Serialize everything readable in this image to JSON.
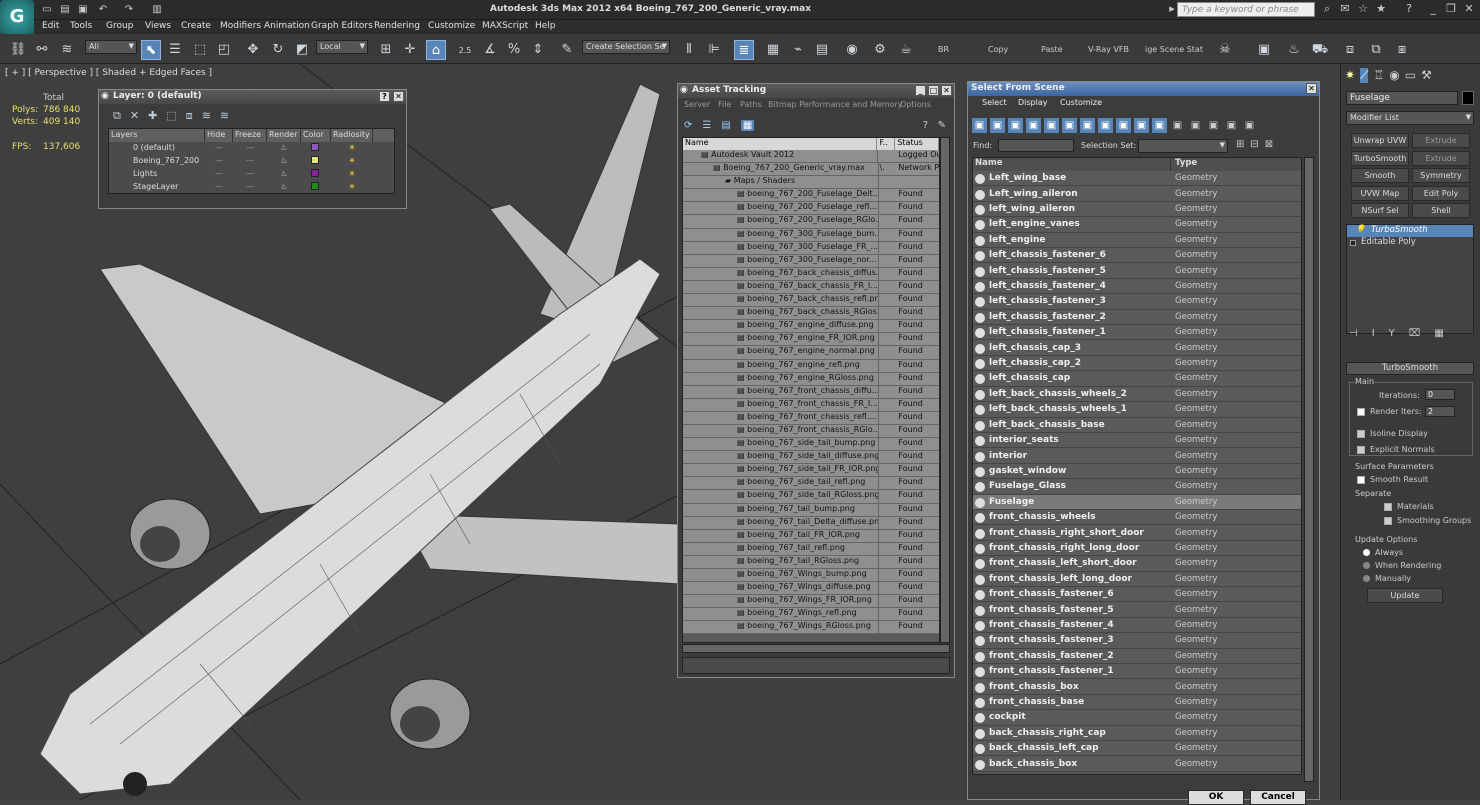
{
  "app": {
    "title": "Autodesk 3ds Max  2012 x64     Boeing_767_200_Generic_vray.max",
    "logo": "3ds-max-logo",
    "help_placeholder": "Type a keyword or phrase"
  },
  "menubar": [
    "Edit",
    "Tools",
    "Group",
    "Views",
    "Create",
    "Modifiers",
    "Animation",
    "Graph Editors",
    "Rendering",
    "Customize",
    "MAXScript",
    "Help"
  ],
  "toolbar": {
    "filter": "All",
    "coord": "Local",
    "snap": "2.5",
    "selset_placeholder": "Create Selection Se",
    "br": "BR",
    "copy": "Copy",
    "paste": "Paste",
    "vray": "V-Ray VFB",
    "stat": "ige Scene Stat"
  },
  "viewport": {
    "label": "[ + ] [ Perspective ] [ Shaded + Edged Faces ]",
    "stats_header": "Total",
    "polys_label": "Polys:",
    "polys": "786 840",
    "verts_label": "Verts:",
    "verts": "409 140",
    "fps_label": "FPS:",
    "fps": "137,606"
  },
  "layer_window": {
    "title": "Layer: 0 (default)",
    "columns": [
      "Layers",
      "Hide",
      "Freeze",
      "Render",
      "Color",
      "Radiosity"
    ],
    "rows": [
      {
        "name": "0 (default)",
        "color": "#8a5ab4"
      },
      {
        "name": "Boeing_767_200",
        "color": "#e6e67a"
      },
      {
        "name": "Lights",
        "color": "#8c1f9c"
      },
      {
        "name": "StageLayer",
        "color": "#1f8c1f"
      }
    ]
  },
  "asset_window": {
    "title": "Asset Tracking",
    "menu": [
      "Server",
      "File",
      "Paths",
      "Bitmap Performance and Memory",
      "Options"
    ],
    "columns": [
      "Name",
      "F..",
      "Status"
    ],
    "rows": [
      {
        "name": "Autodesk Vault 2012",
        "f": "",
        "status": "Logged Ou",
        "indent": 1
      },
      {
        "name": "Boeing_767_200_Generic_vray.max",
        "f": "\\.",
        "status": "Network P",
        "indent": 2
      },
      {
        "name": "Maps / Shaders",
        "f": "",
        "status": "",
        "indent": 3
      },
      {
        "name": "boeing_767_200_Fuselage_Delt...",
        "f": "",
        "status": "Found",
        "indent": 4
      },
      {
        "name": "boeing_767_200_Fuselage_refl....",
        "f": "",
        "status": "Found",
        "indent": 4
      },
      {
        "name": "boeing_767_200_Fuselage_RGlo...",
        "f": "",
        "status": "Found",
        "indent": 4
      },
      {
        "name": "boeing_767_300_Fuselage_bum...",
        "f": "",
        "status": "Found",
        "indent": 4
      },
      {
        "name": "boeing_767_300_Fuselage_FR_...",
        "f": "",
        "status": "Found",
        "indent": 4
      },
      {
        "name": "boeing_767_300_Fuselage_nor...",
        "f": "",
        "status": "Found",
        "indent": 4
      },
      {
        "name": "boeing_767_back_chassis_diffus...",
        "f": "",
        "status": "Found",
        "indent": 4
      },
      {
        "name": "boeing_767_back_chassis_FR_I...",
        "f": "",
        "status": "Found",
        "indent": 4
      },
      {
        "name": "boeing_767_back_chassis_refl.png",
        "f": "",
        "status": "Found",
        "indent": 4
      },
      {
        "name": "boeing_767_back_chassis_RGlos...",
        "f": "",
        "status": "Found",
        "indent": 4
      },
      {
        "name": "boeing_767_engine_diffuse.png",
        "f": "",
        "status": "Found",
        "indent": 4
      },
      {
        "name": "boeing_767_engine_FR_IOR.png",
        "f": "",
        "status": "Found",
        "indent": 4
      },
      {
        "name": "boeing_767_engine_normal.png",
        "f": "",
        "status": "Found",
        "indent": 4
      },
      {
        "name": "boeing_767_engine_refl.png",
        "f": "",
        "status": "Found",
        "indent": 4
      },
      {
        "name": "boeing_767_engine_RGloss.png",
        "f": "",
        "status": "Found",
        "indent": 4
      },
      {
        "name": "boeing_767_front_chassis_diffu...",
        "f": "",
        "status": "Found",
        "indent": 4
      },
      {
        "name": "boeing_767_front_chassis_FR_I...",
        "f": "",
        "status": "Found",
        "indent": 4
      },
      {
        "name": "boeing_767_front_chassis_refl....",
        "f": "",
        "status": "Found",
        "indent": 4
      },
      {
        "name": "boeing_767_front_chassis_RGlo...",
        "f": "",
        "status": "Found",
        "indent": 4
      },
      {
        "name": "boeing_767_side_tail_bump.png",
        "f": "",
        "status": "Found",
        "indent": 4
      },
      {
        "name": "boeing_767_side_tail_diffuse.png",
        "f": "",
        "status": "Found",
        "indent": 4
      },
      {
        "name": "boeing_767_side_tail_FR_IOR.png",
        "f": "",
        "status": "Found",
        "indent": 4
      },
      {
        "name": "boeing_767_side_tail_refl.png",
        "f": "",
        "status": "Found",
        "indent": 4
      },
      {
        "name": "boeing_767_side_tail_RGloss.png",
        "f": "",
        "status": "Found",
        "indent": 4
      },
      {
        "name": "boeing_767_tail_bump.png",
        "f": "",
        "status": "Found",
        "indent": 4
      },
      {
        "name": "boeing_767_tail_Delta_diffuse.png",
        "f": "",
        "status": "Found",
        "indent": 4
      },
      {
        "name": "boeing_767_tail_FR_IOR.png",
        "f": "",
        "status": "Found",
        "indent": 4
      },
      {
        "name": "boeing_767_tail_refl.png",
        "f": "",
        "status": "Found",
        "indent": 4
      },
      {
        "name": "boeing_767_tail_RGloss.png",
        "f": "",
        "status": "Found",
        "indent": 4
      },
      {
        "name": "boeing_767_Wings_bump.png",
        "f": "",
        "status": "Found",
        "indent": 4
      },
      {
        "name": "boeing_767_Wings_diffuse.png",
        "f": "",
        "status": "Found",
        "indent": 4
      },
      {
        "name": "boeing_767_Wings_FR_IOR.png",
        "f": "",
        "status": "Found",
        "indent": 4
      },
      {
        "name": "boeing_767_Wings_refl.png",
        "f": "",
        "status": "Found",
        "indent": 4
      },
      {
        "name": "boeing_767_Wings_RGloss.png",
        "f": "",
        "status": "Found",
        "indent": 4
      }
    ]
  },
  "select_window": {
    "title": "Select From Scene",
    "menu": [
      "Select",
      "Display",
      "Customize"
    ],
    "find_label": "Find:",
    "selset_label": "Selection Set:",
    "columns": [
      "Name",
      "Type"
    ],
    "ok": "OK",
    "cancel": "Cancel",
    "rows": [
      {
        "name": "Left_wing_base",
        "type": "Geometry"
      },
      {
        "name": "Left_wing_aileron",
        "type": "Geometry"
      },
      {
        "name": "left_wing_aileron",
        "type": "Geometry"
      },
      {
        "name": "left_engine_vanes",
        "type": "Geometry"
      },
      {
        "name": "left_engine",
        "type": "Geometry"
      },
      {
        "name": "left_chassis_fastener_6",
        "type": "Geometry"
      },
      {
        "name": "left_chassis_fastener_5",
        "type": "Geometry"
      },
      {
        "name": "left_chassis_fastener_4",
        "type": "Geometry"
      },
      {
        "name": "left_chassis_fastener_3",
        "type": "Geometry"
      },
      {
        "name": "left_chassis_fastener_2",
        "type": "Geometry"
      },
      {
        "name": "left_chassis_fastener_1",
        "type": "Geometry"
      },
      {
        "name": "left_chassis_cap_3",
        "type": "Geometry"
      },
      {
        "name": "left_chassis_cap_2",
        "type": "Geometry"
      },
      {
        "name": "left_chassis_cap",
        "type": "Geometry"
      },
      {
        "name": "left_back_chassis_wheels_2",
        "type": "Geometry"
      },
      {
        "name": "left_back_chassis_wheels_1",
        "type": "Geometry"
      },
      {
        "name": "left_back_chassis_base",
        "type": "Geometry"
      },
      {
        "name": "interior_seats",
        "type": "Geometry"
      },
      {
        "name": "interior",
        "type": "Geometry"
      },
      {
        "name": "gasket_window",
        "type": "Geometry"
      },
      {
        "name": "Fuselage_Glass",
        "type": "Geometry"
      },
      {
        "name": "Fuselage",
        "type": "Geometry",
        "selected": true
      },
      {
        "name": "front_chassis_wheels",
        "type": "Geometry"
      },
      {
        "name": "front_chassis_right_short_door",
        "type": "Geometry"
      },
      {
        "name": "front_chassis_right_long_door",
        "type": "Geometry"
      },
      {
        "name": "front_chassis_left_short_door",
        "type": "Geometry"
      },
      {
        "name": "front_chassis_left_long_door",
        "type": "Geometry"
      },
      {
        "name": "front_chassis_fastener_6",
        "type": "Geometry"
      },
      {
        "name": "front_chassis_fastener_5",
        "type": "Geometry"
      },
      {
        "name": "front_chassis_fastener_4",
        "type": "Geometry"
      },
      {
        "name": "front_chassis_fastener_3",
        "type": "Geometry"
      },
      {
        "name": "front_chassis_fastener_2",
        "type": "Geometry"
      },
      {
        "name": "front_chassis_fastener_1",
        "type": "Geometry"
      },
      {
        "name": "front_chassis_box",
        "type": "Geometry"
      },
      {
        "name": "front_chassis_base",
        "type": "Geometry"
      },
      {
        "name": "cockpit",
        "type": "Geometry"
      },
      {
        "name": "back_chassis_right_cap",
        "type": "Geometry"
      },
      {
        "name": "back_chassis_left_cap",
        "type": "Geometry"
      },
      {
        "name": "back_chassis_box",
        "type": "Geometry"
      }
    ]
  },
  "command_panel": {
    "object_name": "Fuselage",
    "modifier_list": "Modifier List",
    "buttons": [
      "Unwrap UVW",
      "Extrude",
      "TurboSmooth",
      "Extrude",
      "Smooth",
      "Symmetry",
      "UVW Map",
      "Edit Poly",
      "NSurf Sel",
      "Shell"
    ],
    "stack": [
      "TurboSmooth",
      "Editable Poly"
    ],
    "rollout": "TurboSmooth",
    "main": "Main",
    "iterations_label": "Iterations:",
    "iterations": "0",
    "render_iters_label": "Render Iters:",
    "render_iters": "2",
    "isoline": "Isoline Display",
    "explicit": "Explicit Normals",
    "surface": "Surface Parameters",
    "smooth_result": "Smooth Result",
    "separate": "Separate",
    "materials": "Materials",
    "smoothing_groups": "Smoothing Groups",
    "update_options": "Update Options",
    "always": "Always",
    "when_rendering": "When Rendering",
    "manually": "Manually",
    "update": "Update"
  }
}
